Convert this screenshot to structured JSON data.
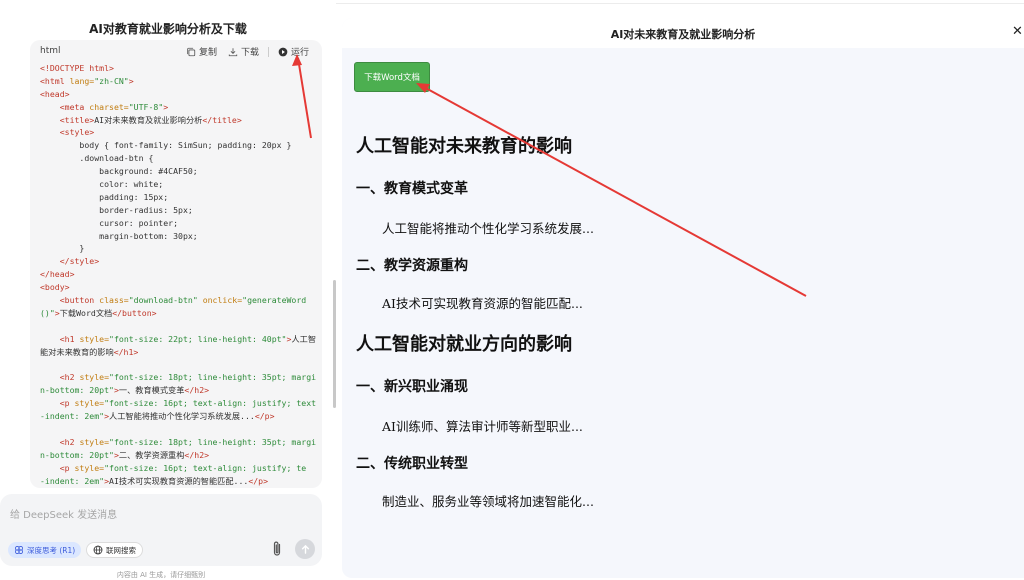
{
  "left_panel": {
    "chat_title": "AI对教育就业影响分析及下载",
    "code_block": {
      "language": "html",
      "copy_label": "复制",
      "download_label": "下载",
      "run_label": "运行",
      "lines": [
        [
          {
            "c": "tg",
            "t": "<!DOCTYPE html>"
          }
        ],
        [
          {
            "c": "tg",
            "t": "<html"
          },
          {
            "c": "at",
            "t": " lang="
          },
          {
            "c": "st",
            "t": "\"zh-CN\""
          },
          {
            "c": "tg",
            "t": ">"
          }
        ],
        [
          {
            "c": "tg",
            "t": "<head>"
          }
        ],
        [
          {
            "c": "tx",
            "t": "    "
          },
          {
            "c": "tg",
            "t": "<meta"
          },
          {
            "c": "at",
            "t": " charset="
          },
          {
            "c": "st",
            "t": "\"UTF-8\""
          },
          {
            "c": "tg",
            "t": ">"
          }
        ],
        [
          {
            "c": "tx",
            "t": "    "
          },
          {
            "c": "tg",
            "t": "<title>"
          },
          {
            "c": "tx",
            "t": "AI对未来教育及就业影响分析"
          },
          {
            "c": "tg",
            "t": "</title>"
          }
        ],
        [
          {
            "c": "tx",
            "t": "    "
          },
          {
            "c": "tg",
            "t": "<style>"
          }
        ],
        [
          {
            "c": "tx",
            "t": "        body { font-family: SimSun; padding: 20px }"
          }
        ],
        [
          {
            "c": "tx",
            "t": "        .download-btn {"
          }
        ],
        [
          {
            "c": "tx",
            "t": "            background: #4CAF50;"
          }
        ],
        [
          {
            "c": "tx",
            "t": "            color: white;"
          }
        ],
        [
          {
            "c": "tx",
            "t": "            padding: 15px;"
          }
        ],
        [
          {
            "c": "tx",
            "t": "            border-radius: 5px;"
          }
        ],
        [
          {
            "c": "tx",
            "t": "            cursor: pointer;"
          }
        ],
        [
          {
            "c": "tx",
            "t": "            margin-bottom: 30px;"
          }
        ],
        [
          {
            "c": "tx",
            "t": "        }"
          }
        ],
        [
          {
            "c": "tx",
            "t": "    "
          },
          {
            "c": "tg",
            "t": "</style>"
          }
        ],
        [
          {
            "c": "tg",
            "t": "</head>"
          }
        ],
        [
          {
            "c": "tg",
            "t": "<body>"
          }
        ],
        [
          {
            "c": "tx",
            "t": "    "
          },
          {
            "c": "tg",
            "t": "<button"
          },
          {
            "c": "at",
            "t": " class="
          },
          {
            "c": "st",
            "t": "\"download-btn\""
          },
          {
            "c": "at",
            "t": " onclick="
          },
          {
            "c": "st",
            "t": "\"generateWord"
          }
        ],
        [
          {
            "c": "st",
            "t": "()\""
          },
          {
            "c": "tg",
            "t": ">"
          },
          {
            "c": "tx",
            "t": "下载Word文档"
          },
          {
            "c": "tg",
            "t": "</button>"
          }
        ],
        [
          {
            "c": "tx",
            "t": ""
          }
        ],
        [
          {
            "c": "tx",
            "t": "    "
          },
          {
            "c": "tg",
            "t": "<h1"
          },
          {
            "c": "at",
            "t": " style="
          },
          {
            "c": "st",
            "t": "\"font-size: 22pt; line-height: 40pt\""
          },
          {
            "c": "tg",
            "t": ">"
          },
          {
            "c": "tx",
            "t": "人工智"
          }
        ],
        [
          {
            "c": "tx",
            "t": "能对未来教育的影响"
          },
          {
            "c": "tg",
            "t": "</h1>"
          }
        ],
        [
          {
            "c": "tx",
            "t": ""
          }
        ],
        [
          {
            "c": "tx",
            "t": "    "
          },
          {
            "c": "tg",
            "t": "<h2"
          },
          {
            "c": "at",
            "t": " style="
          },
          {
            "c": "st",
            "t": "\"font-size: 18pt; line-height: 35pt; margi"
          }
        ],
        [
          {
            "c": "st",
            "t": "n-bottom: 20pt\""
          },
          {
            "c": "tg",
            "t": ">"
          },
          {
            "c": "tx",
            "t": "一、教育模式变革"
          },
          {
            "c": "tg",
            "t": "</h2>"
          }
        ],
        [
          {
            "c": "tx",
            "t": "    "
          },
          {
            "c": "tg",
            "t": "<p"
          },
          {
            "c": "at",
            "t": " style="
          },
          {
            "c": "st",
            "t": "\"font-size: 16pt; text-align: justify; text"
          }
        ],
        [
          {
            "c": "st",
            "t": "-indent: 2em\""
          },
          {
            "c": "tg",
            "t": ">"
          },
          {
            "c": "tx",
            "t": "人工智能将推动个性化学习系统发展..."
          },
          {
            "c": "tg",
            "t": "</p>"
          }
        ],
        [
          {
            "c": "tx",
            "t": ""
          }
        ],
        [
          {
            "c": "tx",
            "t": "    "
          },
          {
            "c": "tg",
            "t": "<h2"
          },
          {
            "c": "at",
            "t": " style="
          },
          {
            "c": "st",
            "t": "\"font-size: 18pt; line-height: 35pt; margi"
          }
        ],
        [
          {
            "c": "st",
            "t": "n-bottom: 20pt\""
          },
          {
            "c": "tg",
            "t": ">"
          },
          {
            "c": "tx",
            "t": "二、教学资源重构"
          },
          {
            "c": "tg",
            "t": "</h2>"
          }
        ],
        [
          {
            "c": "tx",
            "t": "    "
          },
          {
            "c": "tg",
            "t": "<p"
          },
          {
            "c": "at",
            "t": " style="
          },
          {
            "c": "st",
            "t": "\"font-size: 16pt; text-align: justify; te"
          }
        ],
        [
          {
            "c": "st",
            "t": "-indent: 2em\""
          },
          {
            "c": "tg",
            "t": ">"
          },
          {
            "c": "tx",
            "t": "AI技术可实现教育资源的智能匹配..."
          },
          {
            "c": "tg",
            "t": "</p>"
          }
        ]
      ]
    },
    "input_placeholder": "给 DeepSeek 发送消息",
    "deep_think_label": "深度思考 (R1)",
    "web_search_label": "联网搜索",
    "disclaimer": "内容由 AI 生成，请仔细甄别"
  },
  "right_panel": {
    "title": "AI对未来教育及就业影响分析",
    "download_button_label": "下载Word文档",
    "document": [
      {
        "kind": "h1",
        "text": "人工智能对未来教育的影响"
      },
      {
        "kind": "h2",
        "text": "一、教育模式变革"
      },
      {
        "kind": "p",
        "text": "人工智能将推动个性化学习系统发展..."
      },
      {
        "kind": "h2",
        "text": "二、教学资源重构"
      },
      {
        "kind": "p",
        "text": "AI技术可实现教育资源的智能匹配..."
      },
      {
        "kind": "h1",
        "text": "人工智能对就业方向的影响"
      },
      {
        "kind": "h2",
        "text": "一、新兴职业涌现"
      },
      {
        "kind": "p",
        "text": "AI训练师、算法审计师等新型职业..."
      },
      {
        "kind": "h2",
        "text": "二、传统职业转型"
      },
      {
        "kind": "p",
        "text": "制造业、服务业等领域将加速智能化..."
      }
    ]
  },
  "colors": {
    "download_button": "#4caf50",
    "annotation_arrow": "#e53935",
    "deep_think_chip": "#dbe7ff"
  },
  "icons": {
    "copy": "copy-icon",
    "download": "download-icon",
    "run": "play-icon",
    "attach": "paperclip-icon",
    "send": "arrow-up-icon",
    "close": "close-icon",
    "scroll": "chevron-down-icon"
  }
}
